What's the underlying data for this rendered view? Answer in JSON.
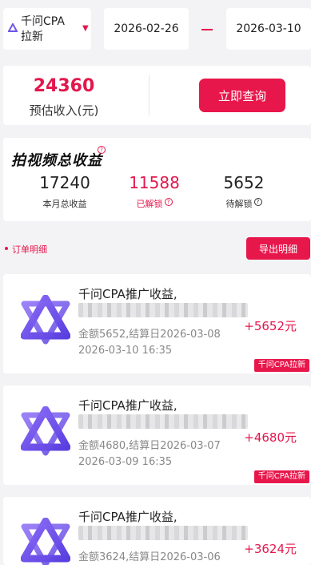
{
  "filter": {
    "product_label": "千问CPA拉新",
    "start_date": "2026-02-26",
    "end_date": "2026-03-10"
  },
  "summary": {
    "amount": "24360",
    "amount_label": "预估收入(元)",
    "query_label": "立即查询"
  },
  "video_income": {
    "title": "拍视频总收益",
    "help_mark": "?",
    "stats": [
      {
        "value": "17240",
        "label": "本月总收益"
      },
      {
        "value": "11588",
        "label": "已解锁"
      },
      {
        "value": "5652",
        "label": "待解锁"
      }
    ]
  },
  "orders": {
    "title": "订单明细",
    "export_label": "导出明细",
    "items": [
      {
        "title": "千问CPA推广收益,",
        "detail": "金额5652,结算日2026-03-08",
        "time": "2026-03-10 16:35",
        "amount": "+5652元",
        "tag": "千问CPA拉新"
      },
      {
        "title": "千问CPA推广收益,",
        "detail": "金额4680,结算日2026-03-07",
        "time": "2026-03-09 16:35",
        "amount": "+4680元",
        "tag": "千问CPA拉新"
      },
      {
        "title": "千问CPA推广收益,",
        "detail": "金额3624,结算日2026-03-06",
        "amount": "+3624元"
      }
    ]
  },
  "colors": {
    "accent": "#e8174b",
    "logo_purple": "#6f55e8",
    "background": "#f3f3f5"
  }
}
